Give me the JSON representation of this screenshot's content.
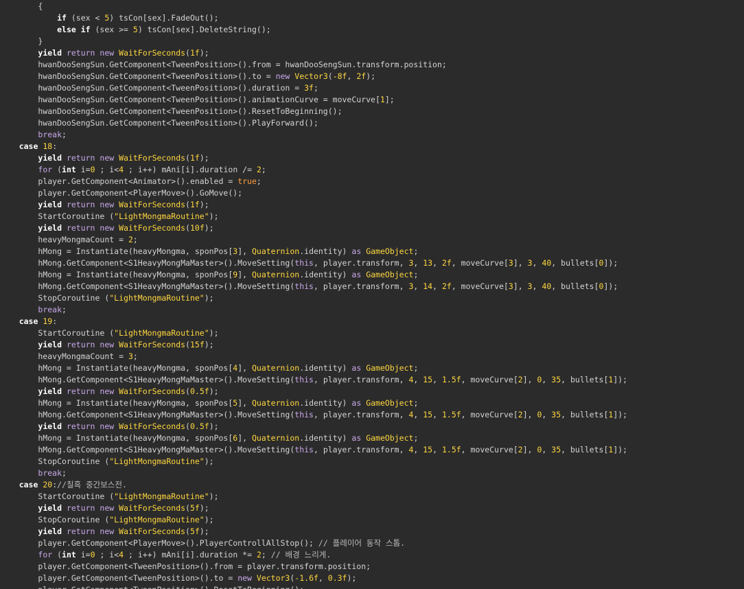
{
  "editor": {
    "colors": {
      "background": "#2b2b2b",
      "text": "#d4d4d4",
      "keyword": "#c8a8e9",
      "keyword_bold": "#ffffff",
      "type": "#ffd740",
      "number": "#ffd740",
      "string": "#ffd740",
      "bool": "#ff9e3d",
      "comment": "#bcbcbc"
    },
    "lines": [
      [
        [
          "tx",
          "        {"
        ]
      ],
      [
        [
          "tx",
          "            "
        ],
        [
          "kwb",
          "if"
        ],
        [
          "tx",
          " (sex < "
        ],
        [
          "num",
          "5"
        ],
        [
          "tx",
          ") tsCon[sex].FadeOut();"
        ]
      ],
      [
        [
          "tx",
          "            "
        ],
        [
          "kwb",
          "else if"
        ],
        [
          "tx",
          " (sex >= "
        ],
        [
          "num",
          "5"
        ],
        [
          "tx",
          ") tsCon[sex].DeleteString();"
        ]
      ],
      [
        [
          "tx",
          "        }"
        ]
      ],
      [
        [
          "tx",
          "        "
        ],
        [
          "kwb",
          "yield"
        ],
        [
          "kw",
          " return new "
        ],
        [
          "ty",
          "WaitForSeconds"
        ],
        [
          "tx",
          "("
        ],
        [
          "num",
          "1f"
        ],
        [
          "tx",
          ");"
        ]
      ],
      [
        [
          "tx",
          "        hwanDooSengSun.GetComponent<TweenPosition>().from = hwanDooSengSun.transform.position;"
        ]
      ],
      [
        [
          "tx",
          "        hwanDooSengSun.GetComponent<TweenPosition>().to = "
        ],
        [
          "kw",
          "new "
        ],
        [
          "ty",
          "Vector3"
        ],
        [
          "tx",
          "("
        ],
        [
          "num",
          "-8f"
        ],
        [
          "tx",
          ", "
        ],
        [
          "num",
          "2f"
        ],
        [
          "tx",
          ");"
        ]
      ],
      [
        [
          "tx",
          "        hwanDooSengSun.GetComponent<TweenPosition>().duration = "
        ],
        [
          "num",
          "3f"
        ],
        [
          "tx",
          ";"
        ]
      ],
      [
        [
          "tx",
          "        hwanDooSengSun.GetComponent<TweenPosition>().animationCurve = moveCurve["
        ],
        [
          "num",
          "1"
        ],
        [
          "tx",
          "];"
        ]
      ],
      [
        [
          "tx",
          "        hwanDooSengSun.GetComponent<TweenPosition>().ResetToBeginning();"
        ]
      ],
      [
        [
          "tx",
          "        hwanDooSengSun.GetComponent<TweenPosition>().PlayForward();"
        ]
      ],
      [
        [
          "tx",
          "        "
        ],
        [
          "kw",
          "break"
        ],
        [
          "tx",
          ";"
        ]
      ],
      [
        [
          "tx",
          "    "
        ],
        [
          "kwb",
          "case"
        ],
        [
          "tx",
          " "
        ],
        [
          "num",
          "18"
        ],
        [
          "tx",
          ":"
        ]
      ],
      [
        [
          "tx",
          "        "
        ],
        [
          "kwb",
          "yield"
        ],
        [
          "kw",
          " return new "
        ],
        [
          "ty",
          "WaitForSeconds"
        ],
        [
          "tx",
          "("
        ],
        [
          "num",
          "1f"
        ],
        [
          "tx",
          ");"
        ]
      ],
      [
        [
          "tx",
          "        "
        ],
        [
          "kw",
          "for"
        ],
        [
          "tx",
          " ("
        ],
        [
          "kwb",
          "int"
        ],
        [
          "tx",
          " i="
        ],
        [
          "num",
          "0"
        ],
        [
          "tx",
          " ; i<"
        ],
        [
          "num",
          "4"
        ],
        [
          "tx",
          " ; i++) mAni[i].duration /= "
        ],
        [
          "num",
          "2"
        ],
        [
          "tx",
          ";"
        ]
      ],
      [
        [
          "tx",
          "        player.GetComponent<Animator>().enabled = "
        ],
        [
          "bool",
          "true"
        ],
        [
          "tx",
          ";"
        ]
      ],
      [
        [
          "tx",
          "        player.GetComponent<PlayerMove>().GoMove();"
        ]
      ],
      [
        [
          "tx",
          "        "
        ],
        [
          "kwb",
          "yield"
        ],
        [
          "kw",
          " return new "
        ],
        [
          "ty",
          "WaitForSeconds"
        ],
        [
          "tx",
          "("
        ],
        [
          "num",
          "1f"
        ],
        [
          "tx",
          ");"
        ]
      ],
      [
        [
          "tx",
          "        StartCoroutine ("
        ],
        [
          "str",
          "\"LightMongmaRoutine\""
        ],
        [
          "tx",
          ");"
        ]
      ],
      [
        [
          "tx",
          "        "
        ],
        [
          "kwb",
          "yield"
        ],
        [
          "kw",
          " return new "
        ],
        [
          "ty",
          "WaitForSeconds"
        ],
        [
          "tx",
          "("
        ],
        [
          "num",
          "10f"
        ],
        [
          "tx",
          ");"
        ]
      ],
      [
        [
          "tx",
          "        heavyMongmaCount = "
        ],
        [
          "num",
          "2"
        ],
        [
          "tx",
          ";"
        ]
      ],
      [
        [
          "tx",
          "        hMong = Instantiate(heavyMongma, sponPos["
        ],
        [
          "num",
          "3"
        ],
        [
          "tx",
          "], "
        ],
        [
          "ty",
          "Quaternion"
        ],
        [
          "tx",
          ".identity) "
        ],
        [
          "kw",
          "as"
        ],
        [
          "tx",
          " "
        ],
        [
          "ty",
          "GameObject"
        ],
        [
          "tx",
          ";"
        ]
      ],
      [
        [
          "tx",
          "        hMong.GetComponent<S1HeavyMongMaMaster>().MoveSetting("
        ],
        [
          "kw",
          "this"
        ],
        [
          "tx",
          ", player.transform, "
        ],
        [
          "num",
          "3"
        ],
        [
          "tx",
          ", "
        ],
        [
          "num",
          "13"
        ],
        [
          "tx",
          ", "
        ],
        [
          "num",
          "2f"
        ],
        [
          "tx",
          ", moveCurve["
        ],
        [
          "num",
          "3"
        ],
        [
          "tx",
          "], "
        ],
        [
          "num",
          "3"
        ],
        [
          "tx",
          ", "
        ],
        [
          "num",
          "40"
        ],
        [
          "tx",
          ", bullets["
        ],
        [
          "num",
          "0"
        ],
        [
          "tx",
          "]);"
        ]
      ],
      [
        [
          "tx",
          "        hMong = Instantiate(heavyMongma, sponPos["
        ],
        [
          "num",
          "9"
        ],
        [
          "tx",
          "], "
        ],
        [
          "ty",
          "Quaternion"
        ],
        [
          "tx",
          ".identity) "
        ],
        [
          "kw",
          "as"
        ],
        [
          "tx",
          " "
        ],
        [
          "ty",
          "GameObject"
        ],
        [
          "tx",
          ";"
        ]
      ],
      [
        [
          "tx",
          "        hMong.GetComponent<S1HeavyMongMaMaster>().MoveSetting("
        ],
        [
          "kw",
          "this"
        ],
        [
          "tx",
          ", player.transform, "
        ],
        [
          "num",
          "3"
        ],
        [
          "tx",
          ", "
        ],
        [
          "num",
          "14"
        ],
        [
          "tx",
          ", "
        ],
        [
          "num",
          "2f"
        ],
        [
          "tx",
          ", moveCurve["
        ],
        [
          "num",
          "3"
        ],
        [
          "tx",
          "], "
        ],
        [
          "num",
          "3"
        ],
        [
          "tx",
          ", "
        ],
        [
          "num",
          "40"
        ],
        [
          "tx",
          ", bullets["
        ],
        [
          "num",
          "0"
        ],
        [
          "tx",
          "]);"
        ]
      ],
      [
        [
          "tx",
          "        StopCoroutine ("
        ],
        [
          "str",
          "\"LightMongmaRoutine\""
        ],
        [
          "tx",
          ");"
        ]
      ],
      [
        [
          "tx",
          "        "
        ],
        [
          "kw",
          "break"
        ],
        [
          "tx",
          ";"
        ]
      ],
      [
        [
          "tx",
          "    "
        ],
        [
          "kwb",
          "case"
        ],
        [
          "tx",
          " "
        ],
        [
          "num",
          "19"
        ],
        [
          "tx",
          ":"
        ]
      ],
      [
        [
          "tx",
          "        StartCoroutine ("
        ],
        [
          "str",
          "\"LightMongmaRoutine\""
        ],
        [
          "tx",
          ");"
        ]
      ],
      [
        [
          "tx",
          "        "
        ],
        [
          "kwb",
          "yield"
        ],
        [
          "kw",
          " return new "
        ],
        [
          "ty",
          "WaitForSeconds"
        ],
        [
          "tx",
          "("
        ],
        [
          "num",
          "15f"
        ],
        [
          "tx",
          ");"
        ]
      ],
      [
        [
          "tx",
          "        heavyMongmaCount = "
        ],
        [
          "num",
          "3"
        ],
        [
          "tx",
          ";"
        ]
      ],
      [
        [
          "tx",
          "        hMong = Instantiate(heavyMongma, sponPos["
        ],
        [
          "num",
          "4"
        ],
        [
          "tx",
          "], "
        ],
        [
          "ty",
          "Quaternion"
        ],
        [
          "tx",
          ".identity) "
        ],
        [
          "kw",
          "as"
        ],
        [
          "tx",
          " "
        ],
        [
          "ty",
          "GameObject"
        ],
        [
          "tx",
          ";"
        ]
      ],
      [
        [
          "tx",
          "        hMong.GetComponent<S1HeavyMongMaMaster>().MoveSetting("
        ],
        [
          "kw",
          "this"
        ],
        [
          "tx",
          ", player.transform, "
        ],
        [
          "num",
          "4"
        ],
        [
          "tx",
          ", "
        ],
        [
          "num",
          "15"
        ],
        [
          "tx",
          ", "
        ],
        [
          "num",
          "1.5f"
        ],
        [
          "tx",
          ", moveCurve["
        ],
        [
          "num",
          "2"
        ],
        [
          "tx",
          "], "
        ],
        [
          "num",
          "0"
        ],
        [
          "tx",
          ", "
        ],
        [
          "num",
          "35"
        ],
        [
          "tx",
          ", bullets["
        ],
        [
          "num",
          "1"
        ],
        [
          "tx",
          "]);"
        ]
      ],
      [
        [
          "tx",
          "        "
        ],
        [
          "kwb",
          "yield"
        ],
        [
          "kw",
          " return new "
        ],
        [
          "ty",
          "WaitForSeconds"
        ],
        [
          "tx",
          "("
        ],
        [
          "num",
          "0.5f"
        ],
        [
          "tx",
          ");"
        ]
      ],
      [
        [
          "tx",
          "        hMong = Instantiate(heavyMongma, sponPos["
        ],
        [
          "num",
          "5"
        ],
        [
          "tx",
          "], "
        ],
        [
          "ty",
          "Quaternion"
        ],
        [
          "tx",
          ".identity) "
        ],
        [
          "kw",
          "as"
        ],
        [
          "tx",
          " "
        ],
        [
          "ty",
          "GameObject"
        ],
        [
          "tx",
          ";"
        ]
      ],
      [
        [
          "tx",
          "        hMong.GetComponent<S1HeavyMongMaMaster>().MoveSetting("
        ],
        [
          "kw",
          "this"
        ],
        [
          "tx",
          ", player.transform, "
        ],
        [
          "num",
          "4"
        ],
        [
          "tx",
          ", "
        ],
        [
          "num",
          "15"
        ],
        [
          "tx",
          ", "
        ],
        [
          "num",
          "1.5f"
        ],
        [
          "tx",
          ", moveCurve["
        ],
        [
          "num",
          "2"
        ],
        [
          "tx",
          "], "
        ],
        [
          "num",
          "0"
        ],
        [
          "tx",
          ", "
        ],
        [
          "num",
          "35"
        ],
        [
          "tx",
          ", bullets["
        ],
        [
          "num",
          "1"
        ],
        [
          "tx",
          "]);"
        ]
      ],
      [
        [
          "tx",
          "        "
        ],
        [
          "kwb",
          "yield"
        ],
        [
          "kw",
          " return new "
        ],
        [
          "ty",
          "WaitForSeconds"
        ],
        [
          "tx",
          "("
        ],
        [
          "num",
          "0.5f"
        ],
        [
          "tx",
          ");"
        ]
      ],
      [
        [
          "tx",
          "        hMong = Instantiate(heavyMongma, sponPos["
        ],
        [
          "num",
          "6"
        ],
        [
          "tx",
          "], "
        ],
        [
          "ty",
          "Quaternion"
        ],
        [
          "tx",
          ".identity) "
        ],
        [
          "kw",
          "as"
        ],
        [
          "tx",
          " "
        ],
        [
          "ty",
          "GameObject"
        ],
        [
          "tx",
          ";"
        ]
      ],
      [
        [
          "tx",
          "        hMong.GetComponent<S1HeavyMongMaMaster>().MoveSetting("
        ],
        [
          "kw",
          "this"
        ],
        [
          "tx",
          ", player.transform, "
        ],
        [
          "num",
          "4"
        ],
        [
          "tx",
          ", "
        ],
        [
          "num",
          "15"
        ],
        [
          "tx",
          ", "
        ],
        [
          "num",
          "1.5f"
        ],
        [
          "tx",
          ", moveCurve["
        ],
        [
          "num",
          "2"
        ],
        [
          "tx",
          "], "
        ],
        [
          "num",
          "0"
        ],
        [
          "tx",
          ", "
        ],
        [
          "num",
          "35"
        ],
        [
          "tx",
          ", bullets["
        ],
        [
          "num",
          "1"
        ],
        [
          "tx",
          "]);"
        ]
      ],
      [
        [
          "tx",
          "        StopCoroutine ("
        ],
        [
          "str",
          "\"LightMongmaRoutine\""
        ],
        [
          "tx",
          ");"
        ]
      ],
      [
        [
          "tx",
          "        "
        ],
        [
          "kw",
          "break"
        ],
        [
          "tx",
          ";"
        ]
      ],
      [
        [
          "tx",
          "    "
        ],
        [
          "kwb",
          "case"
        ],
        [
          "tx",
          " "
        ],
        [
          "num",
          "20"
        ],
        [
          "tx",
          ":"
        ],
        [
          "com",
          "//칠흑 중간보스전."
        ]
      ],
      [
        [
          "tx",
          "        StartCoroutine ("
        ],
        [
          "str",
          "\"LightMongmaRoutine\""
        ],
        [
          "tx",
          ");"
        ]
      ],
      [
        [
          "tx",
          "        "
        ],
        [
          "kwb",
          "yield"
        ],
        [
          "kw",
          " return new "
        ],
        [
          "ty",
          "WaitForSeconds"
        ],
        [
          "tx",
          "("
        ],
        [
          "num",
          "5f"
        ],
        [
          "tx",
          ");"
        ]
      ],
      [
        [
          "tx",
          "        StopCoroutine ("
        ],
        [
          "str",
          "\"LightMongmaRoutine\""
        ],
        [
          "tx",
          ");"
        ]
      ],
      [
        [
          "tx",
          "        "
        ],
        [
          "kwb",
          "yield"
        ],
        [
          "kw",
          " return new "
        ],
        [
          "ty",
          "WaitForSeconds"
        ],
        [
          "tx",
          "("
        ],
        [
          "num",
          "5f"
        ],
        [
          "tx",
          ");"
        ]
      ],
      [
        [
          "tx",
          "        player.GetComponent<PlayerMove>().PlayerControllAllStop(); "
        ],
        [
          "com",
          "// 플레이어 동작 스톱."
        ]
      ],
      [
        [
          "tx",
          "        "
        ],
        [
          "kw",
          "for"
        ],
        [
          "tx",
          " ("
        ],
        [
          "kwb",
          "int"
        ],
        [
          "tx",
          " i="
        ],
        [
          "num",
          "0"
        ],
        [
          "tx",
          " ; i<"
        ],
        [
          "num",
          "4"
        ],
        [
          "tx",
          " ; i++) mAni[i].duration *= "
        ],
        [
          "num",
          "2"
        ],
        [
          "tx",
          "; "
        ],
        [
          "com",
          "// 배경 느리게."
        ]
      ],
      [
        [
          "tx",
          "        player.GetComponent<TweenPosition>().from = player.transform.position;"
        ]
      ],
      [
        [
          "tx",
          "        player.GetComponent<TweenPosition>().to = "
        ],
        [
          "kw",
          "new "
        ],
        [
          "ty",
          "Vector3"
        ],
        [
          "tx",
          "("
        ],
        [
          "num",
          "-1.6f"
        ],
        [
          "tx",
          ", "
        ],
        [
          "num",
          "0.3f"
        ],
        [
          "tx",
          ");"
        ]
      ],
      [
        [
          "tx",
          "        player.GetComponent<TweenPosition>().ResetToBeginning();"
        ]
      ]
    ]
  }
}
